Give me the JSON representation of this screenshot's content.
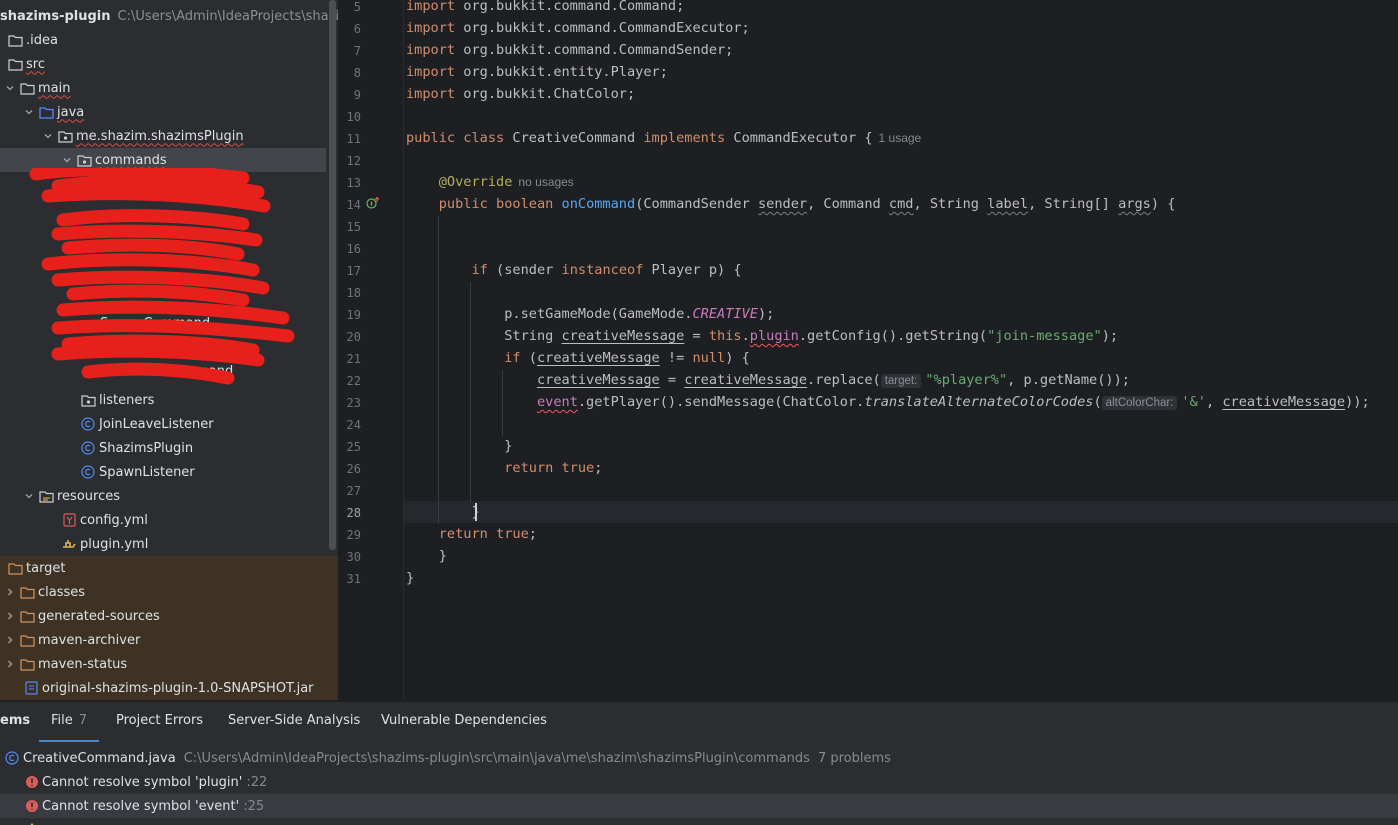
{
  "project_tree": {
    "root": {
      "name": "shazims-plugin",
      "path": "C:\\Users\\Admin\\IdeaProjects\\shazims"
    },
    "items": [
      {
        "label": ".idea"
      },
      {
        "label": "src"
      },
      {
        "label": "main"
      },
      {
        "label": "java"
      },
      {
        "label": "me.shazim.shazimsPlugin"
      },
      {
        "label": "commands"
      },
      {
        "label": "listeners"
      },
      {
        "label": "JoinLeaveListener"
      },
      {
        "label": "ShazimsPlugin"
      },
      {
        "label": "SpawnListener"
      },
      {
        "label": "resources"
      },
      {
        "label": "config.yml"
      },
      {
        "label": "plugin.yml"
      },
      {
        "label": "target"
      },
      {
        "label": "classes"
      },
      {
        "label": "generated-sources"
      },
      {
        "label": "maven-archiver"
      },
      {
        "label": "maven-status"
      },
      {
        "label": "original-shazims-plugin-1.0-SNAPSHOT.jar"
      }
    ],
    "redacted_visible": [
      "SpawnCommand",
      "SurvivalCommand"
    ]
  },
  "editor": {
    "line_numbers": [
      "5",
      "6",
      "7",
      "8",
      "9",
      "10",
      "11",
      "12",
      "13",
      "14",
      "15",
      "16",
      "17",
      "18",
      "19",
      "20",
      "21",
      "22",
      "23",
      "24",
      "25",
      "26",
      "27",
      "28",
      "29",
      "30",
      "31"
    ],
    "current_line": "28",
    "hints": {
      "class_usage": "1 usage",
      "override_usage": "no usages"
    },
    "inlays": {
      "target": "target:",
      "alt_color_char": "altColorChar:"
    }
  },
  "problems": {
    "tabs": [
      {
        "label": "ems"
      },
      {
        "label": "File",
        "count": "7"
      },
      {
        "label": "Project Errors"
      },
      {
        "label": "Server-Side Analysis"
      },
      {
        "label": "Vulnerable Dependencies"
      }
    ],
    "file": {
      "name": "CreativeCommand.java",
      "path": "C:\\Users\\Admin\\IdeaProjects\\shazims-plugin\\src\\main\\java\\me\\shazim\\shazimsPlugin\\commands",
      "count_text": "7 problems"
    },
    "items": [
      {
        "message": "Cannot resolve symbol 'plugin'",
        "line": ":22"
      },
      {
        "message": "Cannot resolve symbol 'event'",
        "line": ":25"
      }
    ]
  },
  "colors": {
    "background": "#1e1f22",
    "panel": "#2b2d30",
    "keyword": "#cf8e6d",
    "string": "#6aab73",
    "method": "#56a8f5",
    "field": "#c77dbb",
    "annotation": "#b3ae60",
    "error": "#db5c5c",
    "accent": "#4a88c7"
  }
}
